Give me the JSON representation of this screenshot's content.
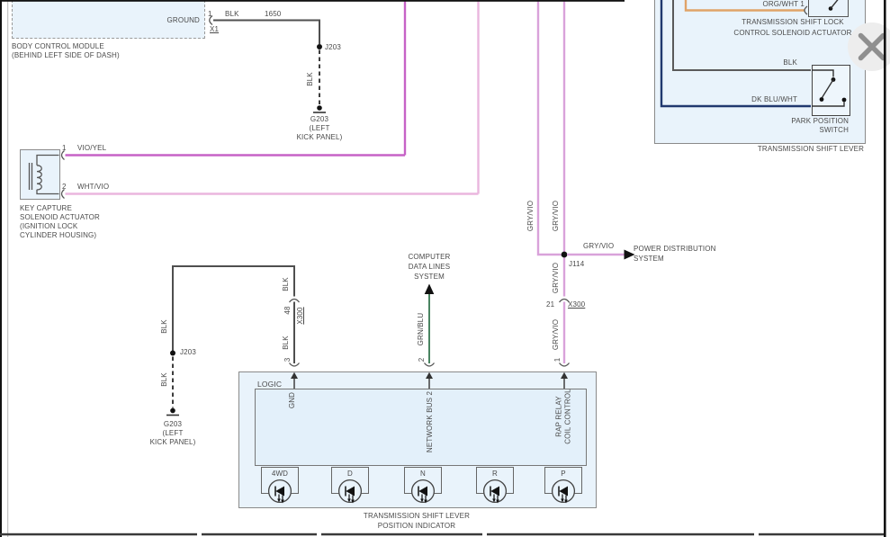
{
  "bcm": {
    "name_line1": "BODY CONTROL MODULE",
    "name_line2": "(BEHIND LEFT SIDE OF DASH)",
    "ground": "GROUND",
    "pin": "1",
    "connector": "X1",
    "circuit": "1650"
  },
  "key_capture": {
    "pin1": "1",
    "pin2": "2",
    "name_line1": "KEY CAPTURE",
    "name_line2": "SOLENOID ACTUATOR",
    "name_line3": "(IGNITION LOCK",
    "name_line4": "CYLINDER HOUSING)"
  },
  "wires": {
    "blk": "BLK",
    "vio_yel": "VIO/YEL",
    "wht_vio": "WHT/VIO",
    "gry_vio": "GRY/VIO",
    "grn_blu": "GRN/BLU",
    "dk_blu_wht": "DK BLU/WHT",
    "org_wht": "ORG/WHT 1"
  },
  "splices": {
    "j203": "J203",
    "j114": "J114"
  },
  "ground_g203": {
    "id": "G203",
    "loc_line1": "(LEFT",
    "loc_line2": "KICK PANEL)"
  },
  "connectors": {
    "x1": "X1",
    "x300": "X300",
    "pin_21": "21",
    "pin_48": "48",
    "pin_1": "1",
    "pin_2": "2",
    "pin_3": "3"
  },
  "shift_lever": {
    "solenoid_name_line1": "TRANSMISSION SHIFT LOCK",
    "solenoid_name_line2": "CONTROL SOLENOID ACTUATOR",
    "switch_name_line1": "PARK POSITION",
    "switch_name_line2": "SWITCH",
    "assembly_name": "TRANSMISSION SHIFT LEVER"
  },
  "power_distribution": {
    "line1": "POWER DISTRIBUTION",
    "line2": "SYSTEM"
  },
  "computer_data": {
    "line1": "COMPUTER",
    "line2": "DATA LINES",
    "line3": "SYSTEM"
  },
  "indicator": {
    "logic": "LOGIC",
    "gnd": "GND",
    "network_bus": "NETWORK BUS 2",
    "rap_relay_line1": "RAP RELAY",
    "rap_relay_line2": "COIL CONTROL",
    "lamps": [
      "4WD",
      "D",
      "N",
      "R",
      "P"
    ],
    "name_line1": "TRANSMISSION SHIFT LEVER",
    "name_line2": "POSITION INDICATOR"
  },
  "icons": {
    "close": "close-x"
  },
  "colors": {
    "box_fill": "#e9f3fb",
    "wire_black": "#4f4f4f",
    "wire_vio_yel": "#c662c6",
    "wire_wht_vio": "#eab6de",
    "wire_gry_vio": "#d9a2da",
    "wire_org_wht": "#e0a368",
    "wire_dk_blu_wht": "#20386e",
    "wire_grn_blu": "#4a8461"
  }
}
